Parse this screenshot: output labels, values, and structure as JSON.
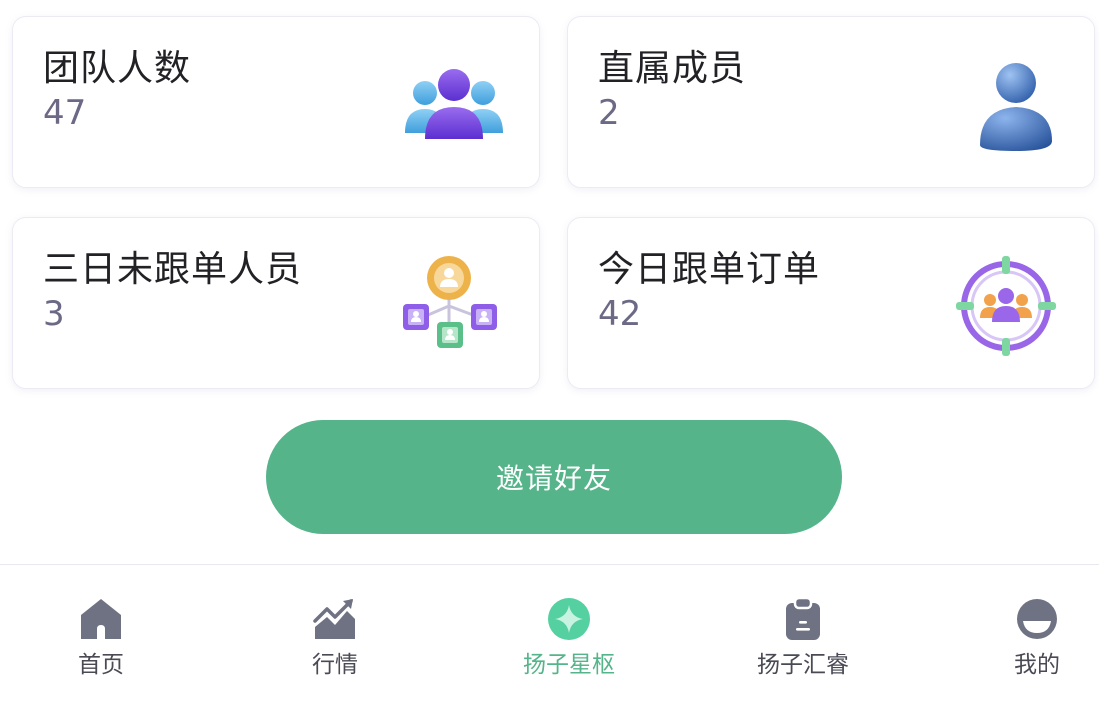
{
  "stats": {
    "team_count": {
      "label": "团队人数",
      "value": "47",
      "icon": "team-group-icon"
    },
    "direct_members": {
      "label": "直属成员",
      "value": "2",
      "icon": "member-person-icon"
    },
    "idle_three_days": {
      "label": "三日未跟单人员",
      "value": "3",
      "icon": "network-people-icon"
    },
    "today_orders": {
      "label": "今日跟单订单",
      "value": "42",
      "icon": "target-group-icon"
    }
  },
  "invite_button": {
    "label": "邀请好友"
  },
  "tabbar": {
    "active": "扬子星枢",
    "accent_color": "#55b48a",
    "items": [
      {
        "label": "首页",
        "icon": "home-icon"
      },
      {
        "label": "行情",
        "icon": "chart-trend-icon"
      },
      {
        "label": "扬子星枢",
        "icon": "sparkle-icon"
      },
      {
        "label": "扬子汇睿",
        "icon": "clipboard-icon"
      },
      {
        "label": "我的",
        "icon": "profile-icon"
      }
    ]
  }
}
